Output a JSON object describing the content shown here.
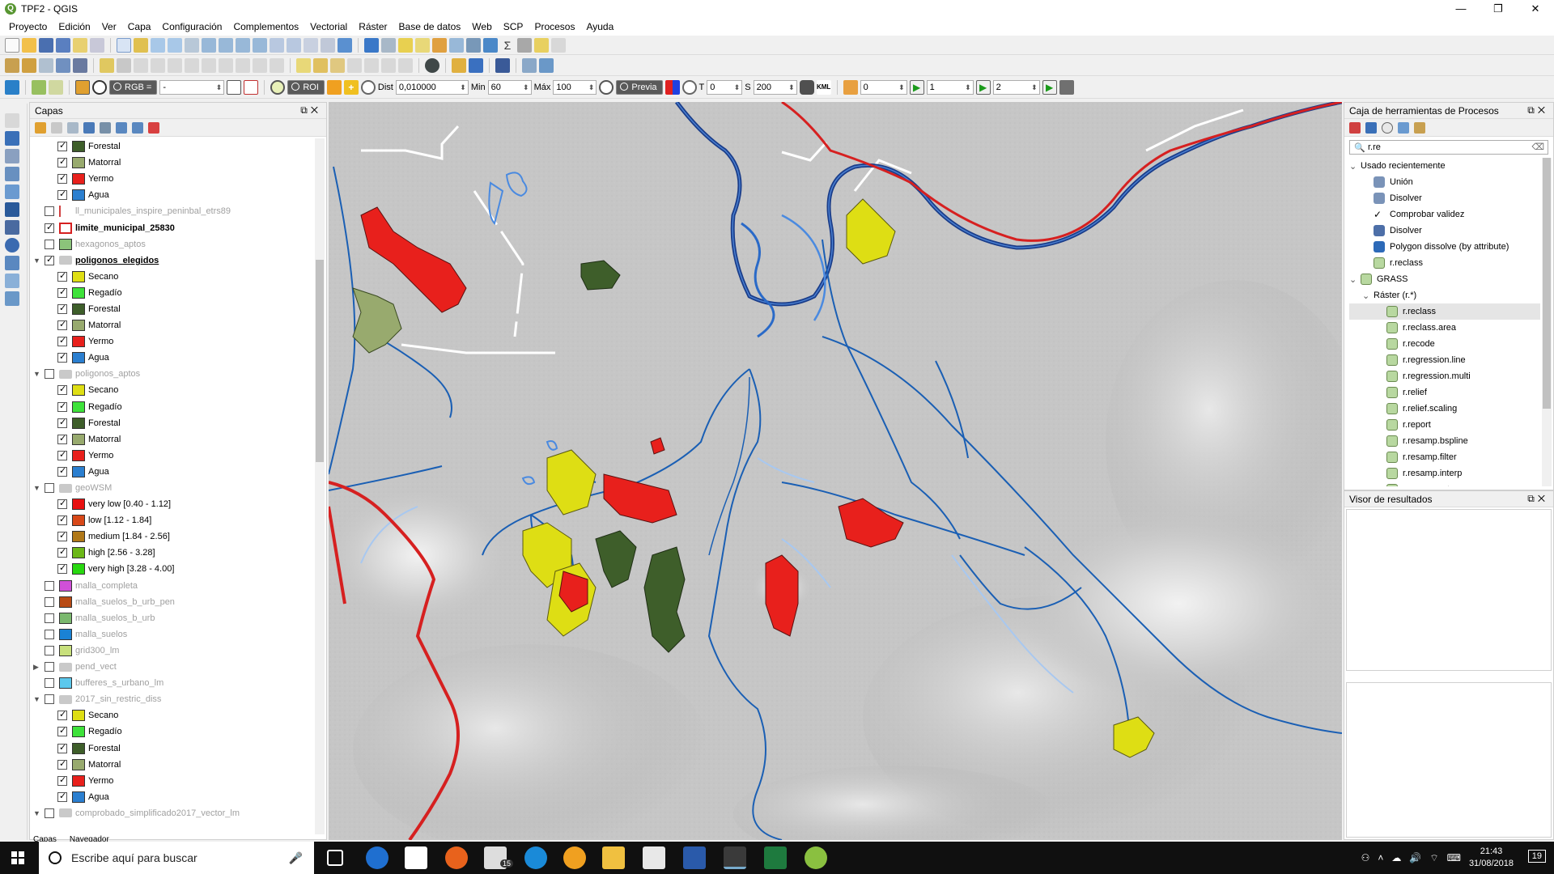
{
  "window": {
    "title": "TPF2 - QGIS",
    "logo": "Q"
  },
  "menu": [
    "Proyecto",
    "Edición",
    "Ver",
    "Capa",
    "Configuración",
    "Complementos",
    "Vectorial",
    "Ráster",
    "Base de datos",
    "Web",
    "SCP",
    "Procesos",
    "Ayuda"
  ],
  "scp_toolbar": {
    "rgb_label": "RGB =",
    "rgb_value": "-",
    "roi_label": "ROI",
    "dist_label": "Dist",
    "dist_value": "0,010000",
    "min_label": "Min",
    "min_value": "60",
    "max_label": "Máx",
    "max_value": "100",
    "preview_label": "Previa",
    "t_label": "T",
    "t_value": "0",
    "s_label": "S",
    "s_value": "200",
    "kml_label": "KML",
    "v1": "0",
    "v2": "1",
    "v3": "2"
  },
  "layers_panel": {
    "title": "Capas",
    "rows": [
      {
        "indent": 2,
        "check": true,
        "label": "Forestal",
        "swatch": "#3e5e2a"
      },
      {
        "indent": 2,
        "check": true,
        "label": "Matorral",
        "swatch": "#98aa6e"
      },
      {
        "indent": 2,
        "check": true,
        "label": "Yermo",
        "swatch": "#e8201c"
      },
      {
        "indent": 2,
        "check": true,
        "label": "Agua",
        "swatch": "#2b7fd0"
      },
      {
        "indent": 1,
        "check": false,
        "label": "ll_municipales_inspire_peninbal_etrs89",
        "style": "gray",
        "icon": "line"
      },
      {
        "indent": 1,
        "check": true,
        "label": "limite_municipal_25830",
        "style": "bold",
        "swatch": "#ffffff",
        "border": "#d62020"
      },
      {
        "indent": 1,
        "check": false,
        "label": "hexagonos_aptos",
        "style": "gray",
        "swatch": "#8bc37a"
      },
      {
        "indent": 1,
        "check": true,
        "label": "poligonos_elegidos",
        "style": "bold uline",
        "group": true,
        "expanded": true
      },
      {
        "indent": 2,
        "check": true,
        "label": "Secano",
        "swatch": "#dede14"
      },
      {
        "indent": 2,
        "check": true,
        "label": "Regadío",
        "swatch": "#3ee23a"
      },
      {
        "indent": 2,
        "check": true,
        "label": "Forestal",
        "swatch": "#3e5e2a"
      },
      {
        "indent": 2,
        "check": true,
        "label": "Matorral",
        "swatch": "#98aa6e"
      },
      {
        "indent": 2,
        "check": true,
        "label": "Yermo",
        "swatch": "#e8201c"
      },
      {
        "indent": 2,
        "check": true,
        "label": "Agua",
        "swatch": "#2b7fd0"
      },
      {
        "indent": 1,
        "check": false,
        "label": "poligonos_aptos",
        "style": "gray",
        "group": true,
        "expanded": true
      },
      {
        "indent": 2,
        "check": true,
        "label": "Secano",
        "swatch": "#dede14"
      },
      {
        "indent": 2,
        "check": true,
        "label": "Regadío",
        "swatch": "#3ee23a"
      },
      {
        "indent": 2,
        "check": true,
        "label": "Forestal",
        "swatch": "#3e5e2a"
      },
      {
        "indent": 2,
        "check": true,
        "label": "Matorral",
        "swatch": "#98aa6e"
      },
      {
        "indent": 2,
        "check": true,
        "label": "Yermo",
        "swatch": "#e8201c"
      },
      {
        "indent": 2,
        "check": true,
        "label": "Agua",
        "swatch": "#2b7fd0"
      },
      {
        "indent": 1,
        "check": false,
        "label": "geoWSM",
        "style": "gray",
        "group": true,
        "expanded": true
      },
      {
        "indent": 2,
        "check": true,
        "label": "very low [0.40 - 1.12]",
        "swatch": "#e81010"
      },
      {
        "indent": 2,
        "check": true,
        "label": "low [1.12 - 1.84]",
        "swatch": "#d84818"
      },
      {
        "indent": 2,
        "check": true,
        "label": "medium [1.84 - 2.56]",
        "swatch": "#b07818"
      },
      {
        "indent": 2,
        "check": true,
        "label": "high [2.56 - 3.28]",
        "swatch": "#6cb818"
      },
      {
        "indent": 2,
        "check": true,
        "label": "very high [3.28 - 4.00]",
        "swatch": "#28d810"
      },
      {
        "indent": 1,
        "check": false,
        "label": "malla_completa",
        "style": "gray",
        "swatch": "#d050d8"
      },
      {
        "indent": 1,
        "check": false,
        "label": "malla_suelos_b_urb_pen",
        "style": "gray",
        "swatch": "#b84a14"
      },
      {
        "indent": 1,
        "check": false,
        "label": "malla_suelos_b_urb",
        "style": "gray",
        "swatch": "#7ab86e"
      },
      {
        "indent": 1,
        "check": false,
        "label": "malla_suelos",
        "style": "gray",
        "swatch": "#1a82d4"
      },
      {
        "indent": 1,
        "check": false,
        "label": "grid300_lm",
        "style": "gray",
        "swatch": "#c8e07c"
      },
      {
        "indent": 1,
        "check": false,
        "label": "pend_vect",
        "style": "gray",
        "group": true,
        "expanded": false
      },
      {
        "indent": 1,
        "check": false,
        "label": "bufferes_s_urbano_lm",
        "style": "gray",
        "swatch": "#5cc8ec"
      },
      {
        "indent": 1,
        "check": false,
        "label": "2017_sin_restric_diss",
        "style": "gray",
        "group": true,
        "expanded": true
      },
      {
        "indent": 2,
        "check": true,
        "label": "Secano",
        "swatch": "#dede14"
      },
      {
        "indent": 2,
        "check": true,
        "label": "Regadío",
        "swatch": "#3ee23a"
      },
      {
        "indent": 2,
        "check": true,
        "label": "Forestal",
        "swatch": "#3e5e2a"
      },
      {
        "indent": 2,
        "check": true,
        "label": "Matorral",
        "swatch": "#98aa6e"
      },
      {
        "indent": 2,
        "check": true,
        "label": "Yermo",
        "swatch": "#e8201c"
      },
      {
        "indent": 2,
        "check": true,
        "label": "Agua",
        "swatch": "#2b7fd0"
      },
      {
        "indent": 1,
        "check": false,
        "label": "comprobado_simplificado2017_vector_lm",
        "style": "gray",
        "group": true,
        "expanded": true
      }
    ],
    "bottom_tabs": [
      "Capas",
      "Navegador"
    ]
  },
  "processing": {
    "title": "Caja de herramientas de Procesos",
    "search_value": "r.re",
    "tree": [
      {
        "level": 0,
        "label": "Usado recientemente",
        "arrow": "open"
      },
      {
        "level": 1,
        "label": "Unión",
        "icon": "#7a93b8"
      },
      {
        "level": 1,
        "label": "Disolver",
        "icon": "#7a93b8"
      },
      {
        "level": 1,
        "label": "Comprobar validez",
        "icon": "check"
      },
      {
        "level": 1,
        "label": "Disolver",
        "icon": "#4d6fa8"
      },
      {
        "level": 1,
        "label": "Polygon dissolve (by attribute)",
        "icon": "#2d6ab8"
      },
      {
        "level": 1,
        "label": "r.reclass",
        "icon": "grass"
      },
      {
        "level": 0,
        "label": "GRASS",
        "arrow": "open",
        "icon": "grass"
      },
      {
        "level": 1,
        "label": "Ráster (r.*)",
        "arrow": "open"
      },
      {
        "level": 2,
        "label": "r.reclass",
        "icon": "grass",
        "selected": true
      },
      {
        "level": 2,
        "label": "r.reclass.area",
        "icon": "grass"
      },
      {
        "level": 2,
        "label": "r.recode",
        "icon": "grass"
      },
      {
        "level": 2,
        "label": "r.regression.line",
        "icon": "grass"
      },
      {
        "level": 2,
        "label": "r.regression.multi",
        "icon": "grass"
      },
      {
        "level": 2,
        "label": "r.relief",
        "icon": "grass"
      },
      {
        "level": 2,
        "label": "r.relief.scaling",
        "icon": "grass"
      },
      {
        "level": 2,
        "label": "r.report",
        "icon": "grass"
      },
      {
        "level": 2,
        "label": "r.resamp.bspline",
        "icon": "grass"
      },
      {
        "level": 2,
        "label": "r.resamp.filter",
        "icon": "grass"
      },
      {
        "level": 2,
        "label": "r.resamp.interp",
        "icon": "grass"
      },
      {
        "level": 2,
        "label": "r.resamp.rst",
        "icon": "grass"
      }
    ]
  },
  "results": {
    "title": "Visor de resultados"
  },
  "taskbar": {
    "search_placeholder": "Escribe aquí para buscar",
    "time": "21:43",
    "date": "31/08/2018",
    "notifications": "19",
    "mail_count": "15"
  },
  "colors": {
    "secano": "#dede14",
    "forestal": "#3e5e2a",
    "matorral": "#98aa6e",
    "yermo": "#e8201c",
    "river": "#1a5fb4",
    "boundary": "#d62020"
  }
}
